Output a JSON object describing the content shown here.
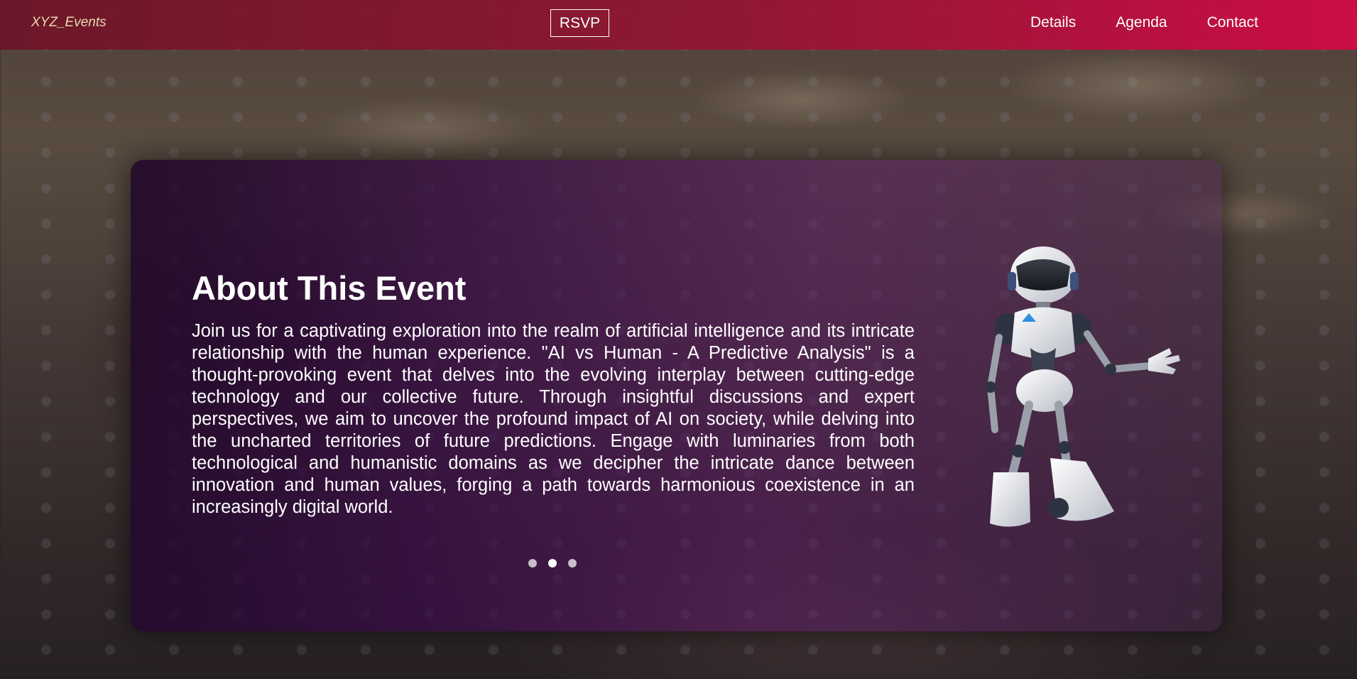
{
  "nav": {
    "brand": "XYZ_Events",
    "rsvp": "RSVP",
    "links": [
      "Details",
      "Agenda",
      "Contact"
    ]
  },
  "about": {
    "title": "About This Event",
    "description": "Join us for a captivating exploration into the realm of artificial intelligence and its intricate relationship with the human experience. \"AI vs Human - A Predictive Analysis\" is a thought-provoking event that delves into the evolving interplay between cutting-edge technology and our collective future. Through insightful discussions and expert perspectives, we aim to uncover the profound impact of AI on society, while delving into the uncharted territories of future predictions. Engage with luminaries from both technological and humanistic domains as we decipher the intricate dance between innovation and human values, forging a path towards harmonious coexistence in an increasingly digital world."
  },
  "carousel": {
    "count": 3,
    "active": 2
  },
  "icons": {
    "illustration": "robot-illustration"
  },
  "colors": {
    "nav_start": "#6e1428",
    "nav_end": "#d20a46",
    "brand_text": "#ead8b0",
    "card_tint": "#37093f"
  }
}
